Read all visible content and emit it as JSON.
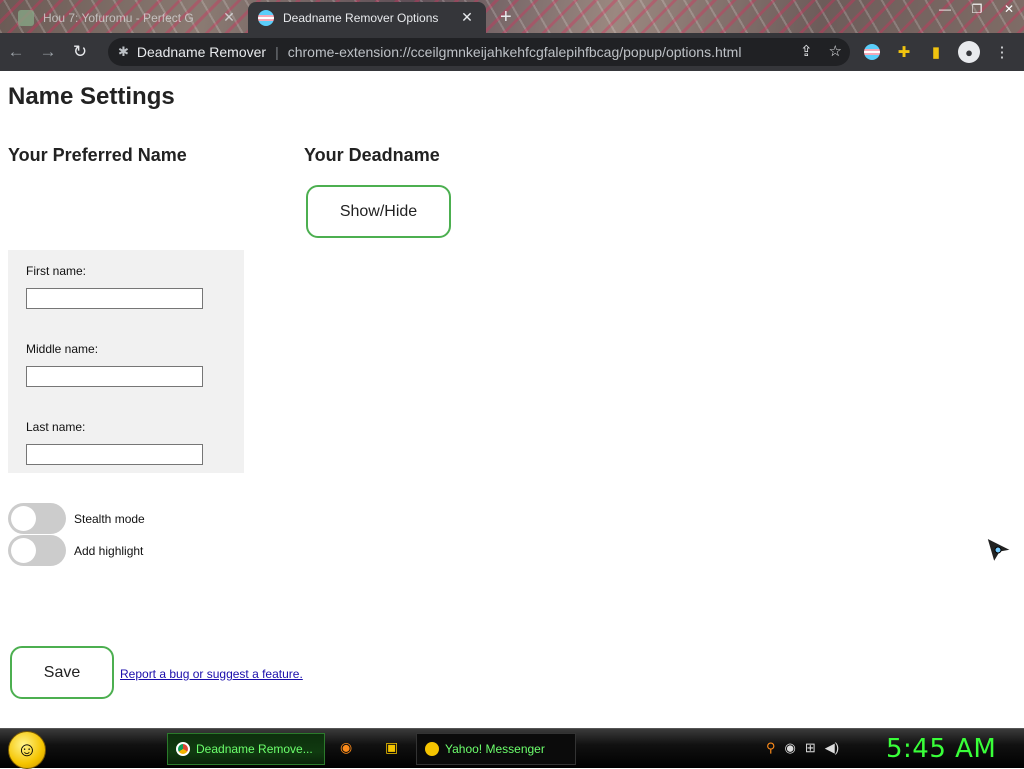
{
  "browser": {
    "tabs": [
      {
        "title": "Hou 7: Yofuromu - Perfect G",
        "close": "✕",
        "active": false
      },
      {
        "title": "Deadname Remover Options",
        "close": "✕",
        "active": true
      }
    ],
    "new_tab": "+",
    "window_controls": [
      "—",
      "❐",
      "✕"
    ],
    "nav": {
      "back": "←",
      "forward": "→",
      "reload": "↻"
    },
    "omnibox": {
      "site_name": "Deadname Remover",
      "url": "chrome-extension://cceilgmnkeijahkehfcgfalepihfbcag/popup/options.html"
    }
  },
  "page": {
    "title": "Name Settings",
    "preferred_heading": "Your Preferred Name",
    "deadname_heading": "Your Deadname",
    "show_hide_label": "Show/Hide",
    "fields": {
      "first_label": "First name:",
      "first_placeholder": "",
      "middle_label": "Middle name:",
      "middle_value": "",
      "last_label": "Last name:",
      "last_value": ""
    },
    "toggles": [
      {
        "label": "Stealth mode",
        "on": false
      },
      {
        "label": "Add highlight",
        "on": false
      }
    ],
    "save_label": "Save",
    "report_link": "Report a bug or suggest a feature."
  },
  "taskbar": {
    "tasks": [
      {
        "label": "Deadname Remove...",
        "icon": "chrome-icon"
      },
      {
        "label": "Yahoo! Messenger",
        "icon": "yahoo-messenger-icon"
      }
    ],
    "clock": "5:45 AM"
  },
  "colors": {
    "accent_border": "#4caf50",
    "chrome_dark": "#35363a",
    "clock_green": "#39ff39"
  }
}
